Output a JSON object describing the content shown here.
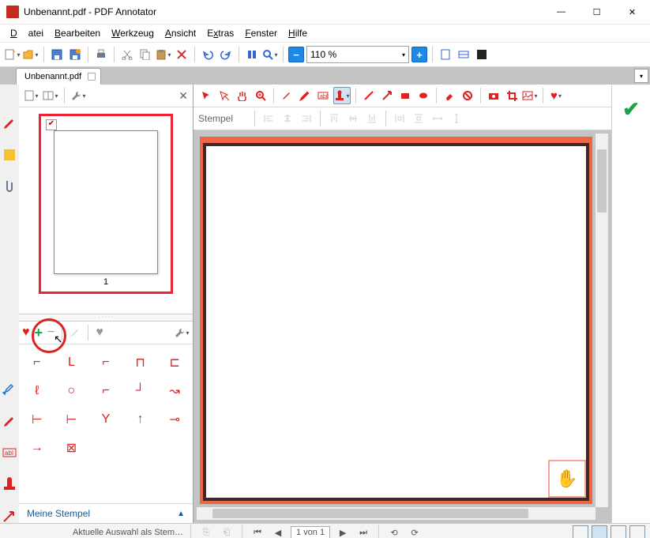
{
  "window": {
    "title": "Unbenannt.pdf - PDF Annotator"
  },
  "menu": {
    "file": "Datei",
    "edit": "Bearbeiten",
    "tool": "Werkzeug",
    "view": "Ansicht",
    "extras": "Extras",
    "window": "Fenster",
    "help": "Hilfe"
  },
  "zoom": {
    "value": "110 %"
  },
  "tab": {
    "label": "Unbenannt.pdf"
  },
  "thumb": {
    "pagenum": "1"
  },
  "stamp_panel": {
    "category": "Meine Stempel"
  },
  "tool_label": {
    "stempel": "Stempel"
  },
  "status": {
    "hint": "Aktuelle Auswahl als Stem…",
    "page": "1 von 1"
  }
}
